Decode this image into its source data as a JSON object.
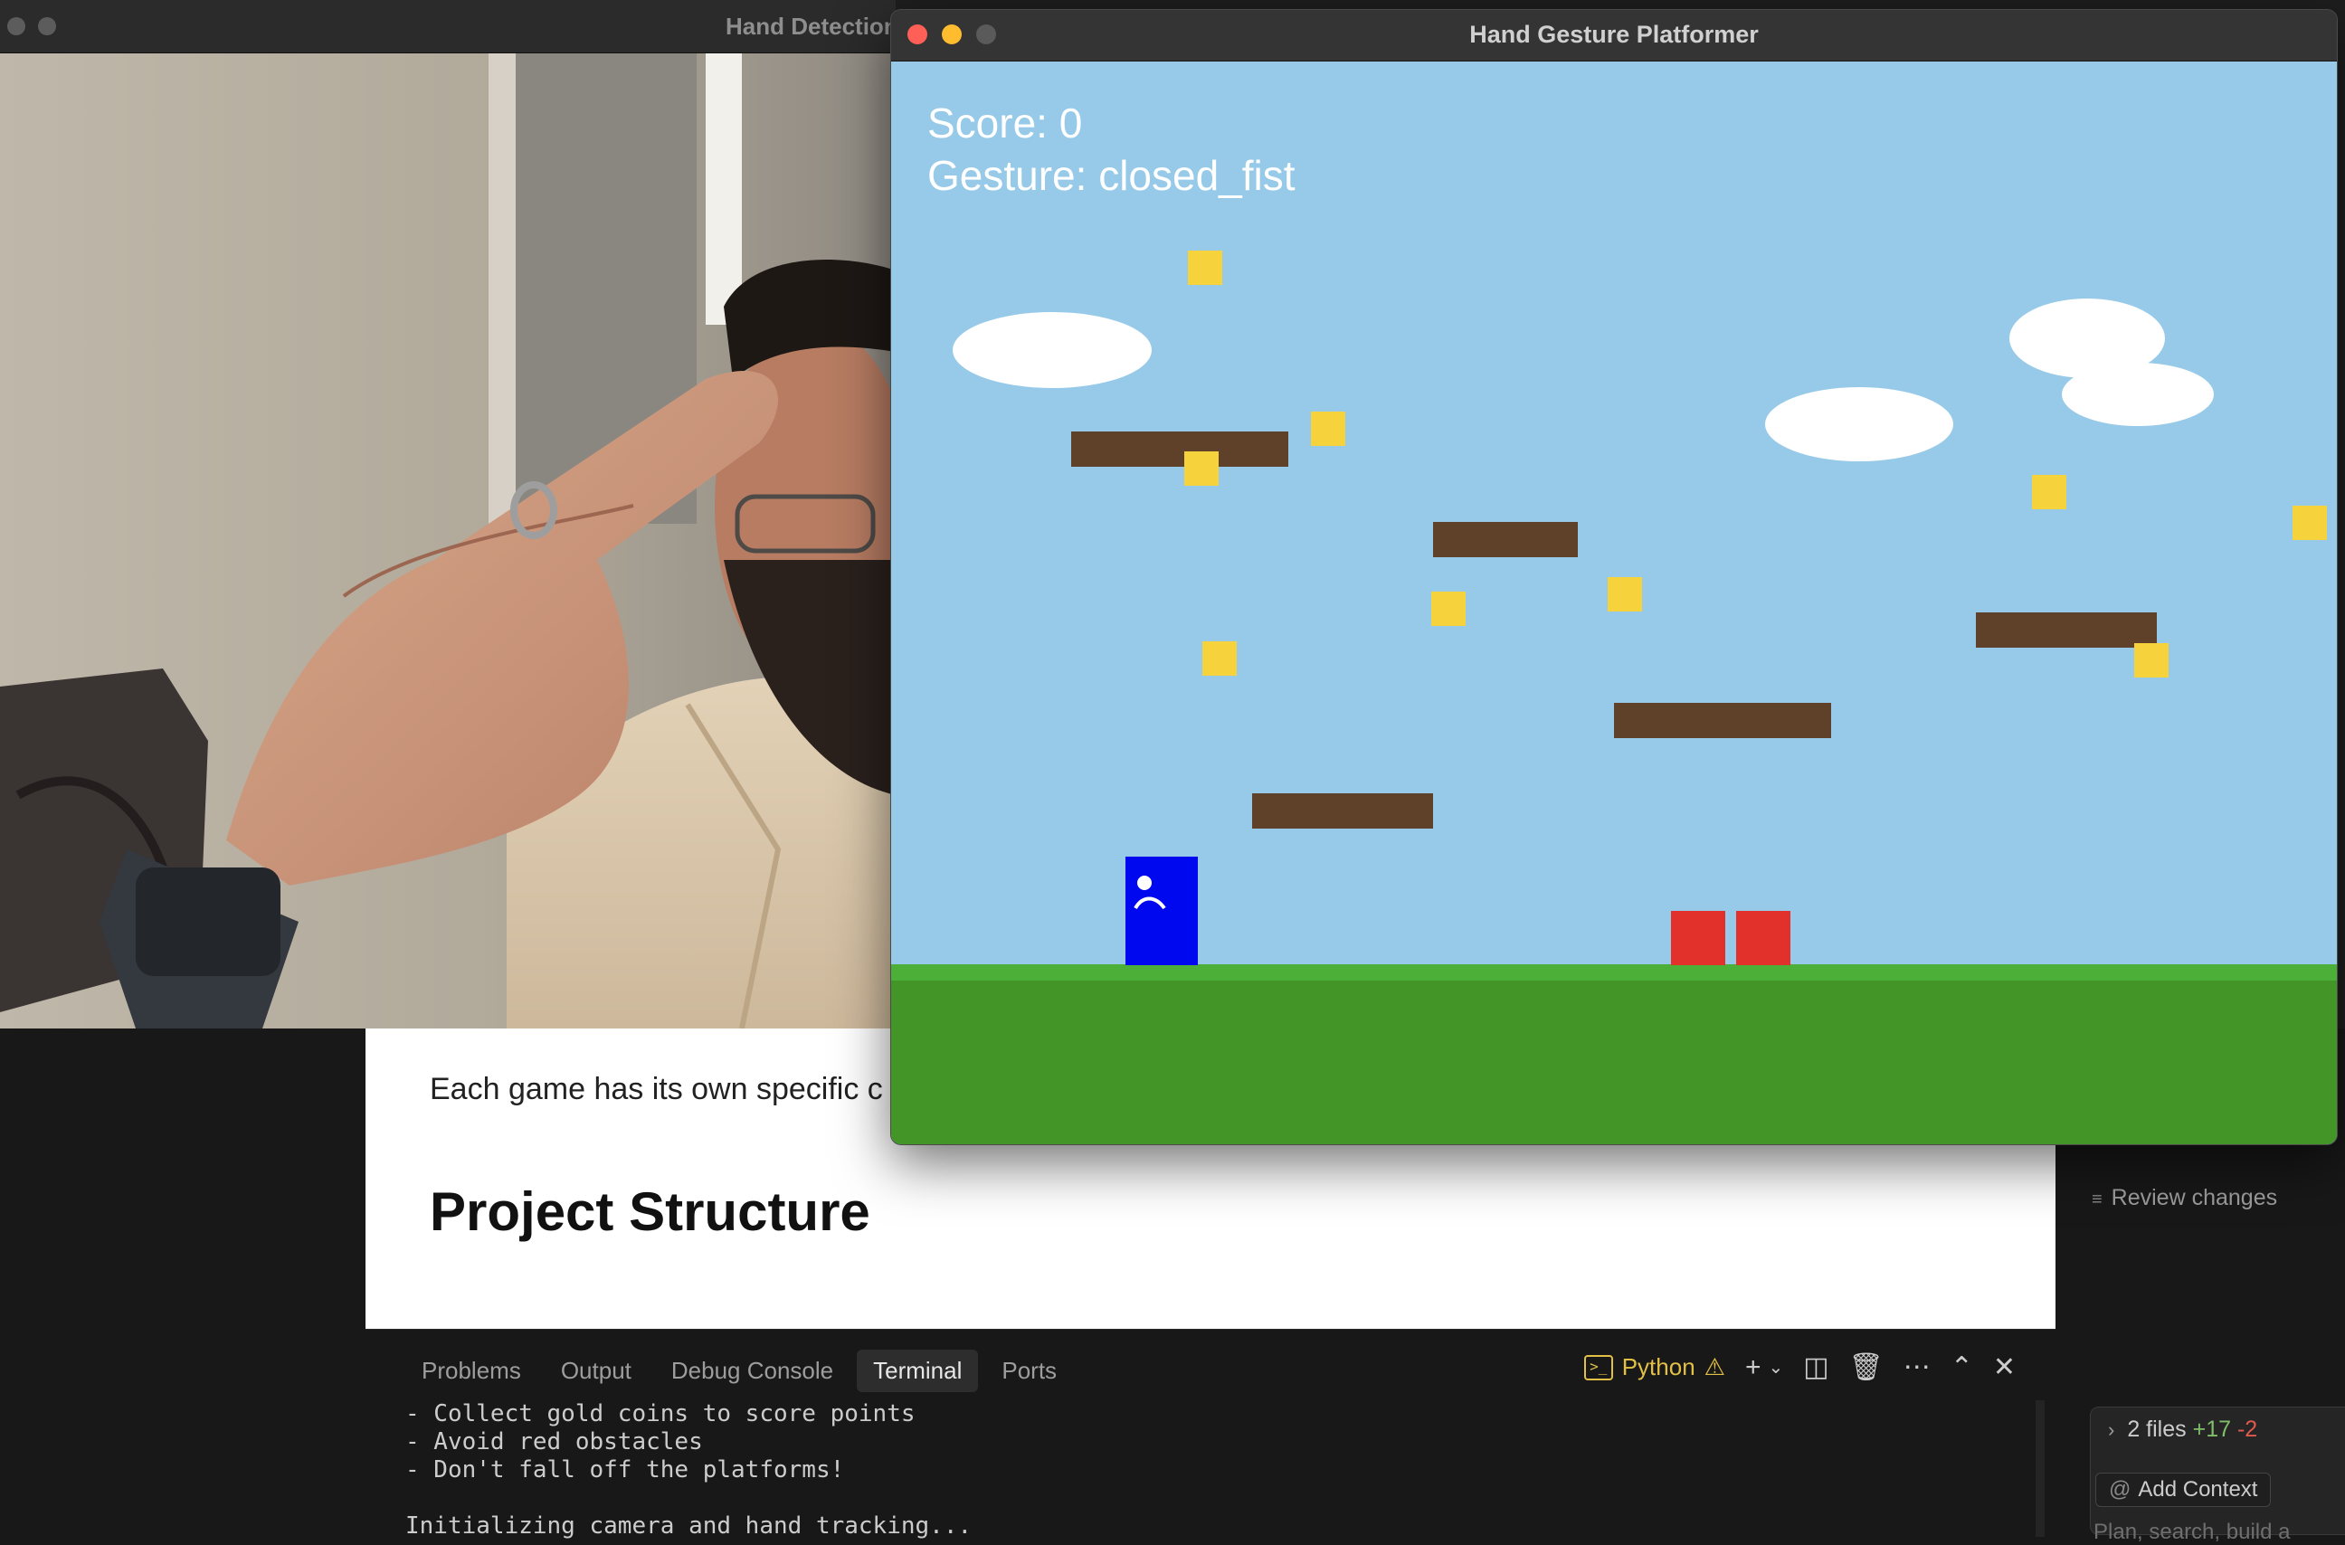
{
  "hand_window": {
    "title": "Hand Detection"
  },
  "game_window": {
    "title": "Hand Gesture Platformer",
    "hud": {
      "score_label": "Score: 0",
      "gesture_label": "Gesture: closed_fist"
    },
    "colors": {
      "sky": "#97cae8",
      "grass_top": "#4caf37",
      "ground": "#449528",
      "platform": "#5e4128",
      "coin": "#f6d33c",
      "obstacle": "#e2312a",
      "player": "#0008ef",
      "cloud": "#ffffff"
    }
  },
  "preview": {
    "paragraph": "Each game has its own specific c",
    "heading": "Project Structure"
  },
  "side_panel": {
    "review_changes": "Review changes",
    "files_summary": "2 files",
    "files_added": "+17",
    "files_removed": "-2",
    "add_context": "Add Context",
    "plan_text": "Plan, search, build a"
  },
  "panel": {
    "tabs": [
      {
        "label": "Problems",
        "active": false
      },
      {
        "label": "Output",
        "active": false
      },
      {
        "label": "Debug Console",
        "active": false
      },
      {
        "label": "Terminal",
        "active": true
      },
      {
        "label": "Ports",
        "active": false
      }
    ],
    "terminal_profile": "Python",
    "terminal_lines": [
      "- Collect gold coins to score points",
      "- Avoid red obstacles",
      "- Don't fall off the platforms!",
      "",
      "Initializing camera and hand tracking..."
    ]
  }
}
